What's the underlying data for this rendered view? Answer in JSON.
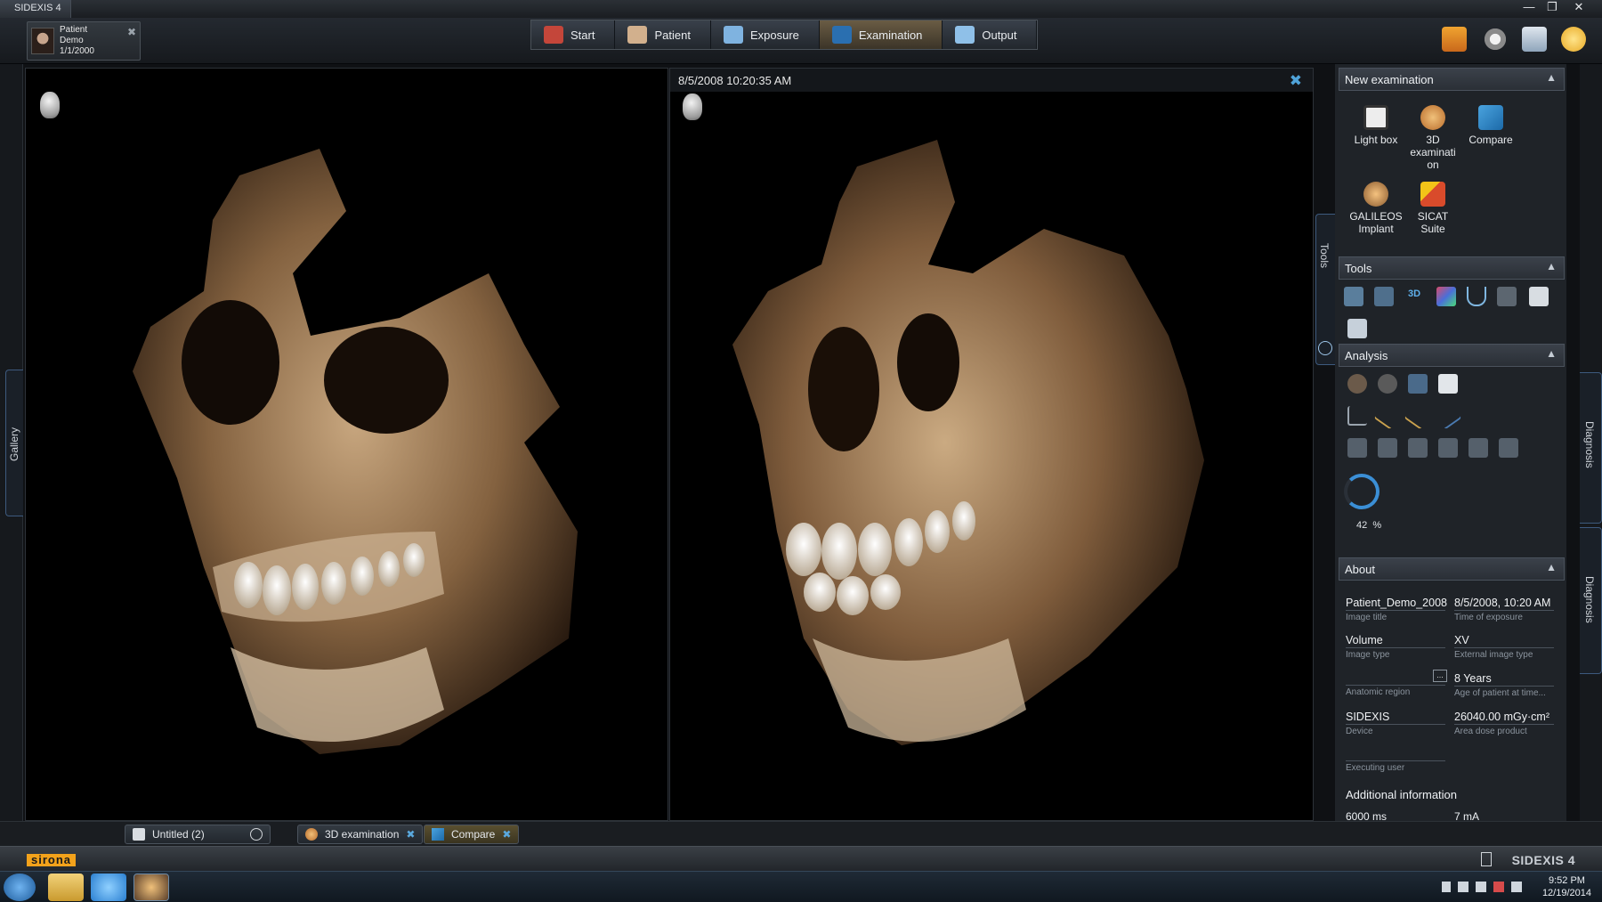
{
  "window": {
    "title": "SIDEXIS 4",
    "minimize": "—",
    "restore": "❐",
    "close": "✕"
  },
  "patient": {
    "name_lines": "Patient\nDemo\n1/1/2000",
    "close": "✖"
  },
  "workflow": [
    {
      "label": "Start",
      "icon": "house-icon",
      "color": "#c4463a"
    },
    {
      "label": "Patient",
      "icon": "person-icon",
      "color": "#d2b08d"
    },
    {
      "label": "Exposure",
      "icon": "exposure-icon",
      "color": "#7fb3e0"
    },
    {
      "label": "Examination",
      "icon": "examination-icon",
      "color": "#2a6fb0"
    },
    {
      "label": "Output",
      "icon": "output-icon",
      "color": "#8fc0e8"
    }
  ],
  "header_icons": [
    "book-icon",
    "gear-icon",
    "monitor-icon",
    "help-icon"
  ],
  "left_rail": {
    "gallery": "Gallery"
  },
  "viewer_right": {
    "timestamp": "8/5/2008 10:20:35 AM",
    "close": "✖"
  },
  "tools_tab": "Tools",
  "diagnosis_tabs": [
    "Diagnosis",
    "Diagnosis"
  ],
  "panel": {
    "new_exam": {
      "title": "New examination",
      "items": [
        {
          "label": "Light box",
          "icon": "lightbox-icon",
          "color": "#ededed"
        },
        {
          "label": "3D examinati on",
          "icon": "3d-examination-icon",
          "color": "#e0a65a"
        },
        {
          "label": "Compare",
          "icon": "compare-icon",
          "color": "#4aa3df"
        },
        {
          "label": "GALILEOS Implant",
          "icon": "implant-icon",
          "color": "#d49a4e"
        },
        {
          "label": "SICAT Suite",
          "icon": "sicat-icon",
          "color": "#d94b2b"
        }
      ]
    },
    "tools": {
      "title": "Tools",
      "third_label": "3D"
    },
    "analysis": {
      "title": "Analysis",
      "percent_value": "42",
      "percent_unit": "%"
    },
    "about": {
      "title": "About",
      "fields": [
        {
          "value": "Patient_Demo_2008",
          "caption": "Image title"
        },
        {
          "value": "8/5/2008, 10:20 AM",
          "caption": "Time of exposure"
        },
        {
          "value": "Volume",
          "caption": "Image type"
        },
        {
          "value": "XV",
          "caption": "External image type"
        },
        {
          "value": "",
          "caption": "Anatomic region"
        },
        {
          "value": "8 Years",
          "caption": "Age of patient at time..."
        },
        {
          "value": "SIDEXIS",
          "caption": "Device"
        },
        {
          "value": "26040.00 mGy·cm²",
          "caption": "Area dose product"
        },
        {
          "value": "",
          "caption": "Executing user"
        }
      ],
      "region_button": "...",
      "additional_title": "Additional information",
      "additional": [
        "6000 ms",
        "7 mA"
      ]
    }
  },
  "tabs": [
    {
      "label": "Untitled (2)",
      "icon": "save-icon"
    },
    {
      "label": "3D examination",
      "icon": "3d-examination-icon"
    },
    {
      "label": "Compare",
      "icon": "compare-icon"
    }
  ],
  "status": {
    "left_logo": "sirona",
    "right_logo": "SIDEXIS 4"
  },
  "taskbar": {
    "time": "9:52 PM",
    "date": "12/19/2014"
  }
}
